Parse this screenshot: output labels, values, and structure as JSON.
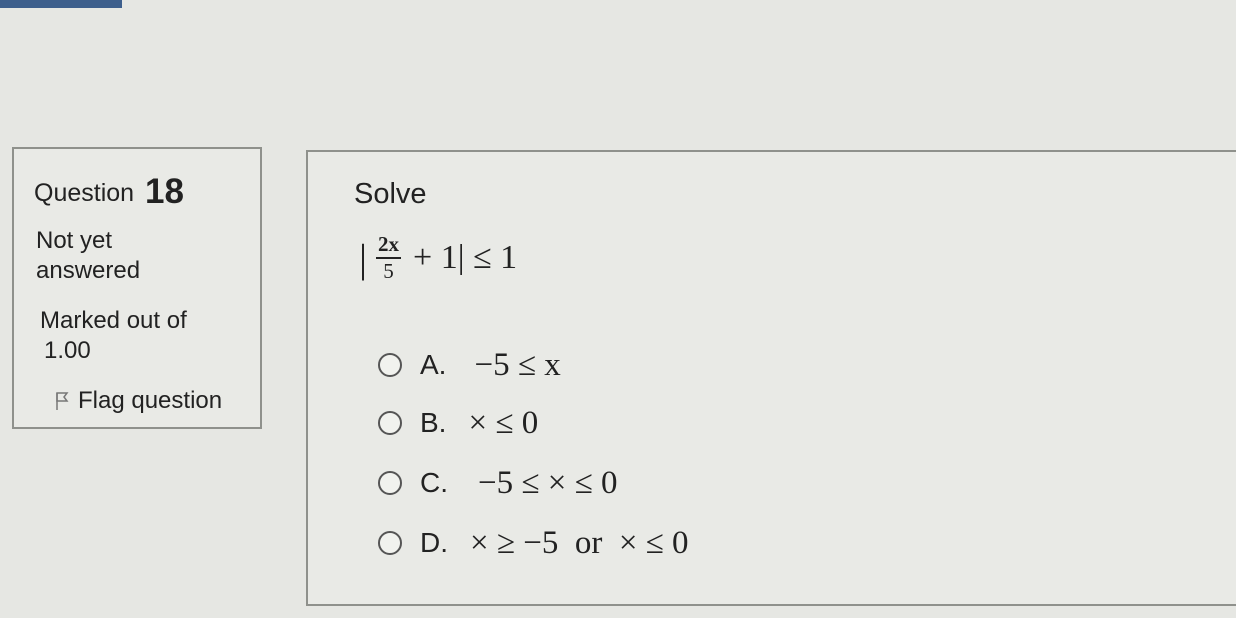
{
  "info": {
    "question_word": "Question",
    "question_number": "18",
    "status_line1": "Not yet",
    "status_line2": "answered",
    "marks_line1": "Marked out of",
    "marks_line2": "1.00",
    "flag_label": "Flag question",
    "flag_icon": "flag-icon"
  },
  "question": {
    "prompt": "Solve",
    "equation": {
      "left_bar": "|",
      "numerator": "2x",
      "denominator": "5",
      "rest": "+ 1| ≤ 1"
    }
  },
  "options": [
    {
      "letter": "A.",
      "text": "−5 ≤ x"
    },
    {
      "letter": "B.",
      "text": "× ≤ 0"
    },
    {
      "letter": "C.",
      "text": "−5 ≤ × ≤ 0"
    },
    {
      "letter": "D.",
      "text": "× ≥ −5  or  × ≤ 0"
    }
  ],
  "colors": {
    "background": "#e6e7e3",
    "tab_accent": "#3d5f8c",
    "border": "#8f918c"
  }
}
